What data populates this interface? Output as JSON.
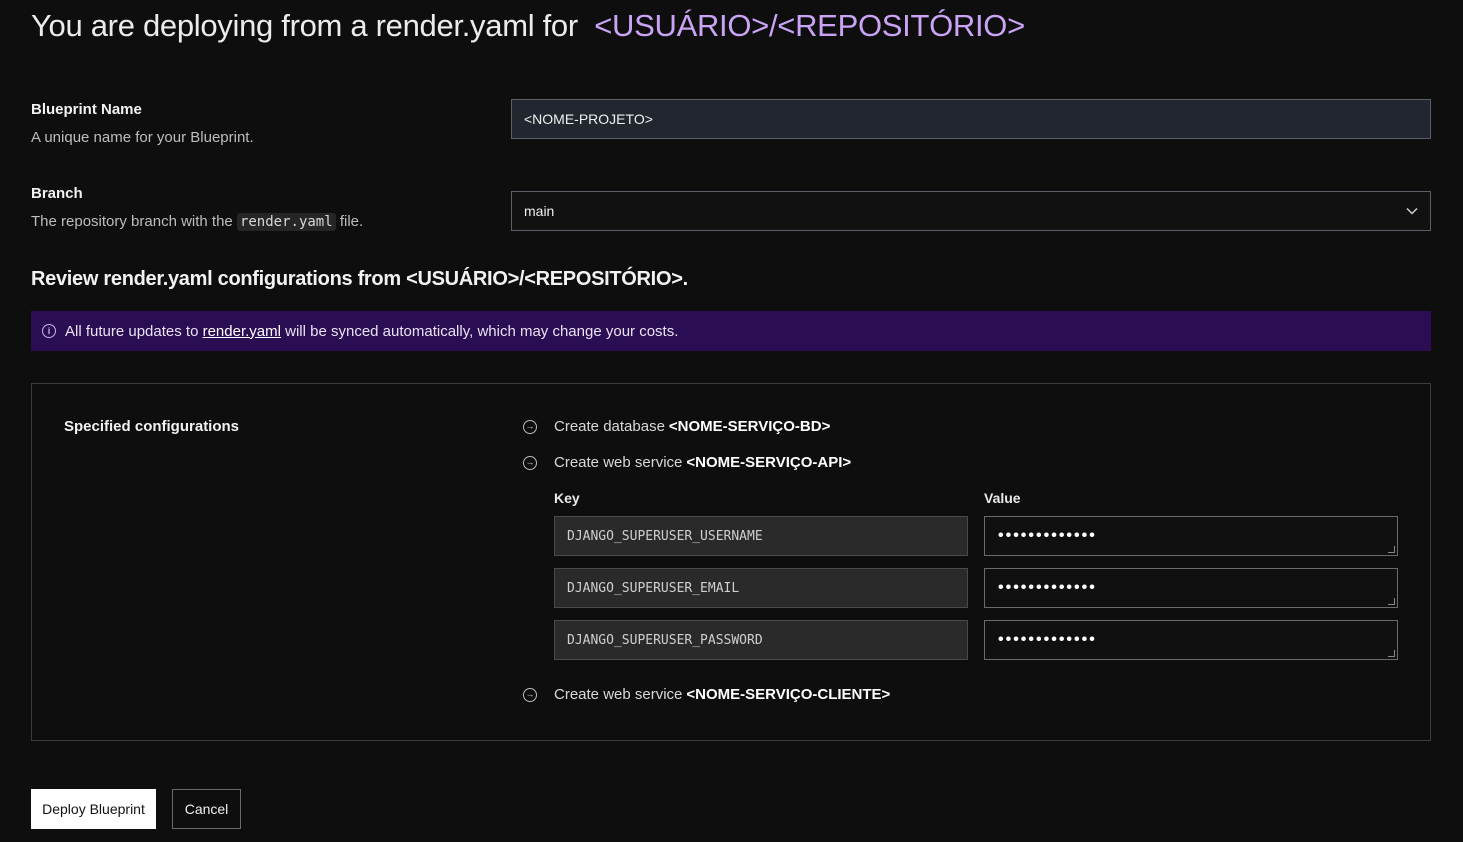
{
  "header": {
    "title_prefix": "You are deploying from a render.yaml for",
    "repo": "<USUÁRIO>/<REPOSITÓRIO>"
  },
  "blueprint_name": {
    "title": "Blueprint Name",
    "description": "A unique name for your Blueprint.",
    "value": "<NOME-PROJETO>"
  },
  "branch": {
    "title": "Branch",
    "description_before": "The repository branch with the",
    "description_code": "render.yaml",
    "description_after": "file.",
    "selected": "main"
  },
  "review": {
    "title": "Review render.yaml configurations from <USUÁRIO>/<REPOSITÓRIO>."
  },
  "banner": {
    "text_before": "All future updates to",
    "link_text": "render.yaml",
    "text_after": "will be synced automatically, which may change your costs."
  },
  "configurations": {
    "title": "Specified configurations",
    "actions": [
      {
        "prefix": "Create database",
        "name": "<NOME-SERVIÇO-BD>"
      },
      {
        "prefix": "Create web service",
        "name": "<NOME-SERVIÇO-API>"
      },
      {
        "prefix": "Create web service",
        "name": "<NOME-SERVIÇO-CLIENTE>"
      }
    ],
    "env_headers": {
      "key": "Key",
      "value": "Value"
    },
    "env_vars": [
      {
        "key": "DJANGO_SUPERUSER_USERNAME",
        "value": "•••••••••••••"
      },
      {
        "key": "DJANGO_SUPERUSER_EMAIL",
        "value": "•••••••••••••"
      },
      {
        "key": "DJANGO_SUPERUSER_PASSWORD",
        "value": "•••••••••••••"
      }
    ]
  },
  "footer": {
    "deploy_label": "Deploy Blueprint",
    "cancel_label": "Cancel"
  },
  "icons": {
    "info": "info-circle-icon",
    "arrow": "arrow-right-circle-icon",
    "chevron": "chevron-down-icon"
  },
  "colors": {
    "background": "#0e0e0e",
    "accent_repo": "#c9a4f5",
    "banner": "#2a0d52"
  }
}
